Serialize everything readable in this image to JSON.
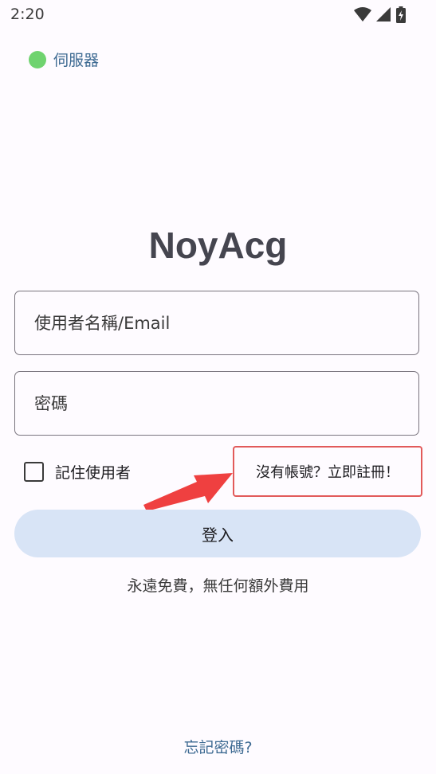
{
  "status_bar": {
    "time": "2:20",
    "icons": [
      "wifi-icon",
      "signal-icon",
      "battery-charging-icon"
    ]
  },
  "server": {
    "label": "伺服器",
    "status_color": "#6fd36f"
  },
  "app": {
    "title": "NoyAcg"
  },
  "form": {
    "username_placeholder": "使用者名稱/Email",
    "username_value": "",
    "password_placeholder": "密碼",
    "password_value": "",
    "remember_label": "記住使用者",
    "remember_checked": false,
    "register_link": "沒有帳號？立即註冊！",
    "login_label": "登入"
  },
  "tagline": "永遠免費，無任何額外費用",
  "forgot_password": "忘記密碼?",
  "colors": {
    "accent": "#3d6a92",
    "highlight": "#e25a5a",
    "login_button_bg": "#d8e4f6"
  }
}
